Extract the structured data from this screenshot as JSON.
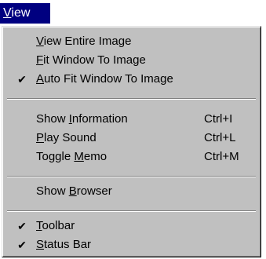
{
  "menu_title": {
    "prefix": "",
    "underlined": "V",
    "rest": "iew"
  },
  "items": [
    {
      "checked": false,
      "pre": "",
      "u": "V",
      "post": "iew Entire Image",
      "shortcut": ""
    },
    {
      "checked": false,
      "pre": "",
      "u": "F",
      "post": "it Window To Image",
      "shortcut": ""
    },
    {
      "checked": true,
      "pre": "",
      "u": "A",
      "post": "uto Fit Window To Image",
      "shortcut": ""
    },
    {
      "checked": false,
      "pre": "Show ",
      "u": "I",
      "post": "nformation",
      "shortcut": "Ctrl+I"
    },
    {
      "checked": false,
      "pre": "",
      "u": "P",
      "post": "lay Sound",
      "shortcut": "Ctrl+L"
    },
    {
      "checked": false,
      "pre": "Toggle ",
      "u": "M",
      "post": "emo",
      "shortcut": "Ctrl+M"
    },
    {
      "checked": false,
      "pre": "Show ",
      "u": "B",
      "post": "rowser",
      "shortcut": ""
    },
    {
      "checked": true,
      "pre": "",
      "u": "T",
      "post": "oolbar",
      "shortcut": ""
    },
    {
      "checked": true,
      "pre": "",
      "u": "S",
      "post": "tatus Bar",
      "shortcut": ""
    }
  ],
  "check_glyph": "✔",
  "colors": {
    "menu_background": "#c0c0c0",
    "title_highlight": "#000080",
    "title_text": "#ffffff"
  }
}
